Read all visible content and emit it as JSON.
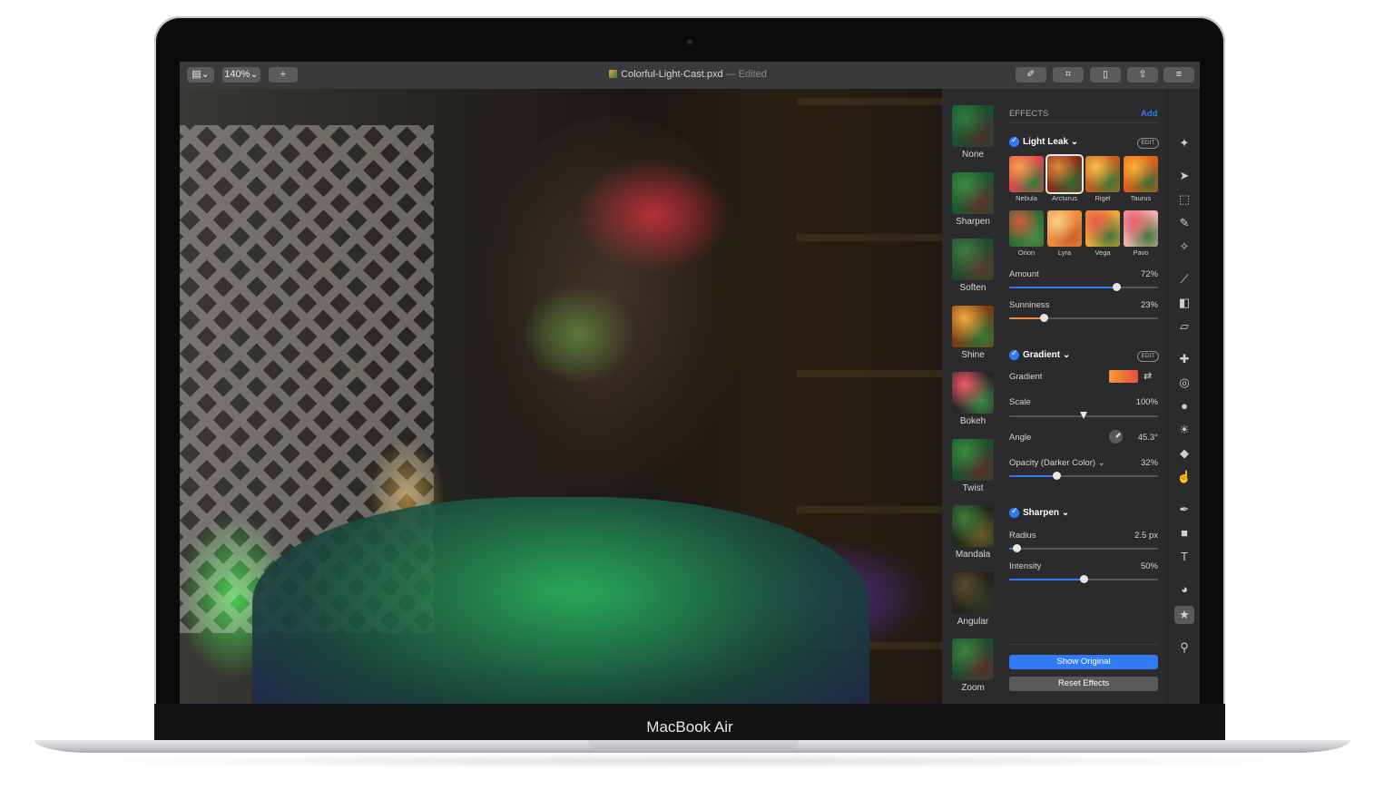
{
  "device": {
    "brand": "MacBook Air"
  },
  "toolbar": {
    "zoom": "140%",
    "sidebar_toggle_icon": "sidebar-icon",
    "add_label": "+",
    "document_title": "Colorful-Light-Cast.pxd",
    "edited_status": "— Edited",
    "right_buttons": [
      "brush-icon",
      "crop-icon",
      "document-icon",
      "share-icon",
      "adjust-icon"
    ]
  },
  "effect_strip": [
    {
      "label": "None",
      "colors": [
        "#1a4f30",
        "#2f7b3a",
        "#4b2d2a"
      ]
    },
    {
      "label": "Sharpen",
      "colors": [
        "#195a2f",
        "#3b8a40",
        "#612e2a"
      ]
    },
    {
      "label": "Soften",
      "colors": [
        "#1f4a2c",
        "#3f7a3e",
        "#5b3a30"
      ]
    },
    {
      "label": "Shine",
      "colors": [
        "#7a3b14",
        "#f2a93a",
        "#2d7a3a"
      ]
    },
    {
      "label": "Bokeh",
      "colors": [
        "#2a2226",
        "#f05a68",
        "#3c8a44"
      ]
    },
    {
      "label": "Twist",
      "colors": [
        "#1b4e2d",
        "#3a8a40",
        "#5a2d2a"
      ]
    },
    {
      "label": "Mandala",
      "colors": [
        "#1c2a1a",
        "#3f7b3a",
        "#6a5a2a"
      ]
    },
    {
      "label": "Angular",
      "colors": [
        "#232019",
        "#5a4a2a",
        "#2f3a25"
      ]
    },
    {
      "label": "Zoom",
      "colors": [
        "#1d4a2c",
        "#3a8440",
        "#5a2d2a"
      ]
    }
  ],
  "panel": {
    "title": "EFFECTS",
    "add_label": "Add",
    "light_leak": {
      "header": "Light Leak",
      "edit_label": "EDIT",
      "presets": [
        {
          "label": "Nebula",
          "colors": [
            "#e2444f",
            "#f3a14a",
            "#2f7a3a"
          ],
          "selected": false
        },
        {
          "label": "Arcturus",
          "colors": [
            "#8a2b18",
            "#d98a3a",
            "#2d6a35"
          ],
          "selected": true
        },
        {
          "label": "Rigel",
          "colors": [
            "#c85a1a",
            "#f6c14a",
            "#3a7a3a"
          ],
          "selected": false
        },
        {
          "label": "Taurus",
          "colors": [
            "#e85a1a",
            "#f7b13a",
            "#356f34"
          ],
          "selected": false
        },
        {
          "label": "Orion",
          "colors": [
            "#2f6a34",
            "#d55a3a",
            "#4a8a44"
          ],
          "selected": false
        },
        {
          "label": "Lyra",
          "colors": [
            "#f08a3a",
            "#f7d08a",
            "#c8602a"
          ],
          "selected": false
        },
        {
          "label": "Vega",
          "colors": [
            "#f0a73a",
            "#e85a4a",
            "#3a7a3a"
          ],
          "selected": false
        },
        {
          "label": "Pavo",
          "colors": [
            "#f0b0b0",
            "#e8606a",
            "#3a7a3a"
          ],
          "selected": false
        }
      ],
      "amount": {
        "label": "Amount",
        "value": "72%",
        "fraction": 0.72,
        "color": "#2f7bf5"
      },
      "sunniness": {
        "label": "Sunniness",
        "value": "23%",
        "fraction": 0.23,
        "color": "#f08a3a"
      }
    },
    "gradient": {
      "header": "Gradient",
      "edit_label": "EDIT",
      "gradient_label": "Gradient",
      "swatch_colors": [
        "#f39a3a",
        "#e8503a"
      ],
      "scale": {
        "label": "Scale",
        "value": "100%",
        "fraction": 0.5
      },
      "angle": {
        "label": "Angle",
        "value": "45.3°"
      },
      "opacity": {
        "label": "Opacity (Darker Color)",
        "value": "32%",
        "fraction": 0.32,
        "color": "#2f7bf5"
      }
    },
    "sharpen": {
      "header": "Sharpen",
      "radius": {
        "label": "Radius",
        "value": "2.5 px",
        "fraction": 0.05,
        "color": "#2f7bf5"
      },
      "intensity": {
        "label": "Intensity",
        "value": "50%",
        "fraction": 0.5,
        "color": "#2f7bf5"
      }
    },
    "show_original": "Show Original",
    "reset_effects": "Reset Effects"
  },
  "tools": [
    {
      "icon": "effects-icon",
      "glyph": "✦"
    },
    {
      "icon": "arrow-icon",
      "glyph": "➤"
    },
    {
      "icon": "rect-select-icon",
      "glyph": "⬚"
    },
    {
      "icon": "lasso-icon",
      "glyph": "✎"
    },
    {
      "icon": "magic-wand-icon",
      "glyph": "✧"
    },
    {
      "icon": "brush-icon",
      "glyph": "⟋"
    },
    {
      "icon": "bucket-icon",
      "glyph": "◧"
    },
    {
      "icon": "eraser-icon",
      "glyph": "▱"
    },
    {
      "icon": "repair-icon",
      "glyph": "✚"
    },
    {
      "icon": "clone-icon",
      "glyph": "◎"
    },
    {
      "icon": "blur-icon",
      "glyph": "●"
    },
    {
      "icon": "light-icon",
      "glyph": "☀"
    },
    {
      "icon": "sponge-icon",
      "glyph": "◆"
    },
    {
      "icon": "smudge-icon",
      "glyph": "☝"
    },
    {
      "icon": "pen-icon",
      "glyph": "✒"
    },
    {
      "icon": "shape-icon",
      "glyph": "■"
    },
    {
      "icon": "text-icon",
      "glyph": "T"
    },
    {
      "icon": "color-icon",
      "glyph": "◕"
    },
    {
      "icon": "star-icon",
      "glyph": "★"
    },
    {
      "icon": "zoom-icon",
      "glyph": "⚲"
    }
  ]
}
